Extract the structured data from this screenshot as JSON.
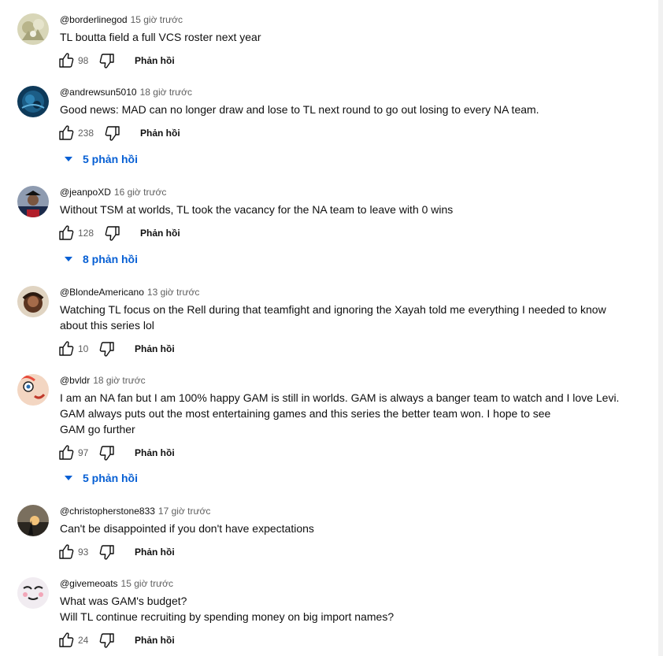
{
  "like_icon_name": "thumb-up-icon",
  "dislike_icon_name": "thumb-down-icon",
  "colors": {
    "link": "#065fd4",
    "muted": "#606060",
    "text": "#0f0f0f"
  },
  "comments": [
    {
      "author": "@borderlinegod",
      "time": "15 giờ trước",
      "text": [
        "TL boutta field a full VCS roster next year"
      ],
      "likes": "98",
      "reply_label": "Phản hồi"
    },
    {
      "author": "@andrewsun5010",
      "time": "18 giờ trước",
      "text": [
        "Good news: MAD can no longer draw and lose to TL next round to go out losing to every NA team."
      ],
      "likes": "238",
      "reply_label": "Phản hồi",
      "replies": "5 phản hồi"
    },
    {
      "author": "@jeanpoXD",
      "time": "16 giờ trước",
      "text": [
        "Without TSM at worlds, TL took the vacancy for the NA team to leave with 0 wins"
      ],
      "likes": "128",
      "reply_label": "Phản hồi",
      "replies": "8 phản hồi"
    },
    {
      "author": "@BlondeAmericano",
      "time": "13 giờ trước",
      "text": [
        "Watching TL focus on the Rell during that teamfight and ignoring the Xayah told me everything I needed to know",
        "about this series lol"
      ],
      "likes": "10",
      "reply_label": "Phản hồi"
    },
    {
      "author": "@bvldr",
      "time": "18 giờ trước",
      "text": [
        "I am an NA fan but I am 100% happy GAM is still in worlds. GAM is always a banger team to watch and I love Levi.",
        "GAM always puts out the most entertaining games and this series the better team won. I hope to see",
        "GAM go further"
      ],
      "likes": "97",
      "reply_label": "Phản hồi",
      "replies": "5 phản hồi"
    },
    {
      "author": "@christopherstone833",
      "time": "17 giờ trước",
      "text": [
        "Can't be disappointed if you don't have expectations"
      ],
      "likes": "93",
      "reply_label": "Phản hồi"
    },
    {
      "author": "@givemeoats",
      "time": "15 giờ trước",
      "text": [
        "What was GAM's budget?",
        "Will TL continue recruiting by spending money on big import names?"
      ],
      "likes": "24",
      "reply_label": "Phản hồi"
    }
  ]
}
